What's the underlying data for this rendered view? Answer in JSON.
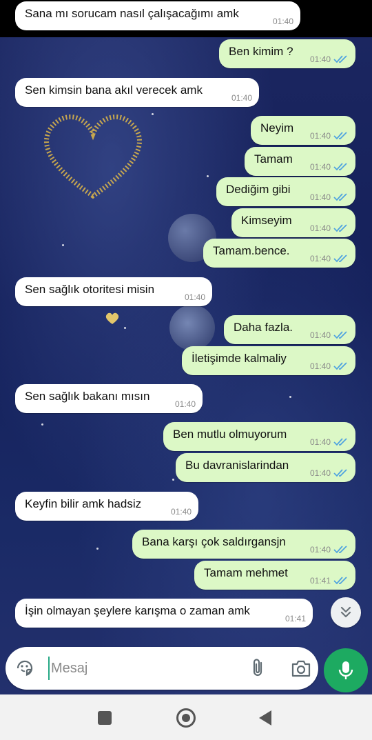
{
  "messages": [
    {
      "dir": "in",
      "text": "Sana mı sorucam nasıl çalışacağımı amk",
      "time": "01:40"
    },
    {
      "dir": "out",
      "text": "Ben kimim ?",
      "time": "01:40"
    },
    {
      "dir": "in",
      "text": "Sen kimsin bana akıl verecek amk",
      "time": "01:40"
    },
    {
      "dir": "out",
      "text": "Neyim",
      "time": "01:40"
    },
    {
      "dir": "out",
      "text": "Tamam",
      "time": "01:40"
    },
    {
      "dir": "out",
      "text": "Dediğim gibi",
      "time": "01:40"
    },
    {
      "dir": "out",
      "text": "Kimseyim",
      "time": "01:40"
    },
    {
      "dir": "out",
      "text": "Tamam.bence.",
      "time": "01:40"
    },
    {
      "dir": "in",
      "text": "Sen sağlık otoritesi misin",
      "time": "01:40"
    },
    {
      "dir": "out",
      "text": "Daha fazla.",
      "time": "01:40"
    },
    {
      "dir": "out",
      "text": "İletişimde kalmaliy",
      "time": "01:40"
    },
    {
      "dir": "in",
      "text": "Sen sağlık bakanı mısın",
      "time": "01:40"
    },
    {
      "dir": "out",
      "text": "Ben mutlu olmuyorum",
      "time": "01:40"
    },
    {
      "dir": "out",
      "text": "Bu davranislarindan",
      "time": "01:40"
    },
    {
      "dir": "in",
      "text": "Keyfin bilir amk hadsiz",
      "time": "01:40"
    },
    {
      "dir": "out",
      "text": "Bana karşı çok saldırgansjn",
      "time": "01:40"
    },
    {
      "dir": "out",
      "text": "Tamam mehmet",
      "time": "01:41"
    },
    {
      "dir": "in",
      "text": "İşin olmayan şeylere karışma o zaman amk",
      "time": "01:41"
    }
  ],
  "composer": {
    "placeholder": "Mesaj",
    "emoji_icon": "sticker-emoji-icon",
    "attach_icon": "paperclip-icon",
    "camera_icon": "camera-icon",
    "mic_icon": "microphone-icon"
  },
  "scroll_down_icon": "double-chevron-down-icon",
  "navigation": {
    "recents_icon": "square-recents-icon",
    "home_icon": "circle-home-icon",
    "back_icon": "triangle-back-icon"
  },
  "colors": {
    "incoming_bubble": "#ffffff",
    "outgoing_bubble": "#dcf8c6",
    "read_tick": "#4fa3e0",
    "accent": "#1daa61"
  }
}
